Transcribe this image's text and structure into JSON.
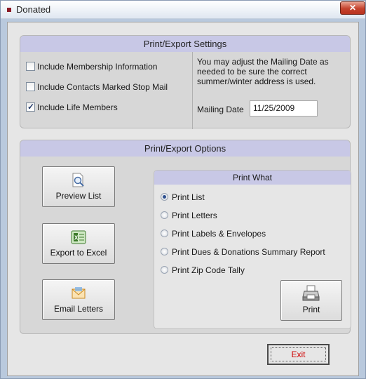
{
  "window": {
    "title": "Donated",
    "close_glyph": "✕"
  },
  "settings": {
    "header": "Print/Export Settings",
    "options": [
      {
        "label": "Include Membership Information",
        "checked": false
      },
      {
        "label": "Include Contacts Marked Stop Mail",
        "checked": false
      },
      {
        "label": "Include Life Members",
        "checked": true
      }
    ],
    "hint_lines": [
      "You may adjust the Mailing Date as",
      "needed to be sure the correct",
      "summer/winter address is used."
    ],
    "mailing_date_label": "Mailing Date",
    "mailing_date_value": "11/25/2009"
  },
  "options_panel": {
    "header": "Print/Export Options",
    "buttons": {
      "preview": "Preview List",
      "export": "Export to Excel",
      "email": "Email Letters"
    }
  },
  "print_what": {
    "header": "Print What",
    "items": [
      {
        "label": "Print List",
        "selected": true
      },
      {
        "label": "Print Letters",
        "selected": false
      },
      {
        "label": "Print Labels & Envelopes",
        "selected": false
      },
      {
        "label": "Print Dues & Donations Summary Report",
        "selected": false
      },
      {
        "label": "Print Zip Code Tally",
        "selected": false
      }
    ],
    "print_button": "Print"
  },
  "footer": {
    "exit_label": "Exit"
  },
  "icons": {
    "preview": "magnifier-document-icon",
    "export": "excel-icon",
    "email": "envelope-icon",
    "print": "printer-icon"
  }
}
